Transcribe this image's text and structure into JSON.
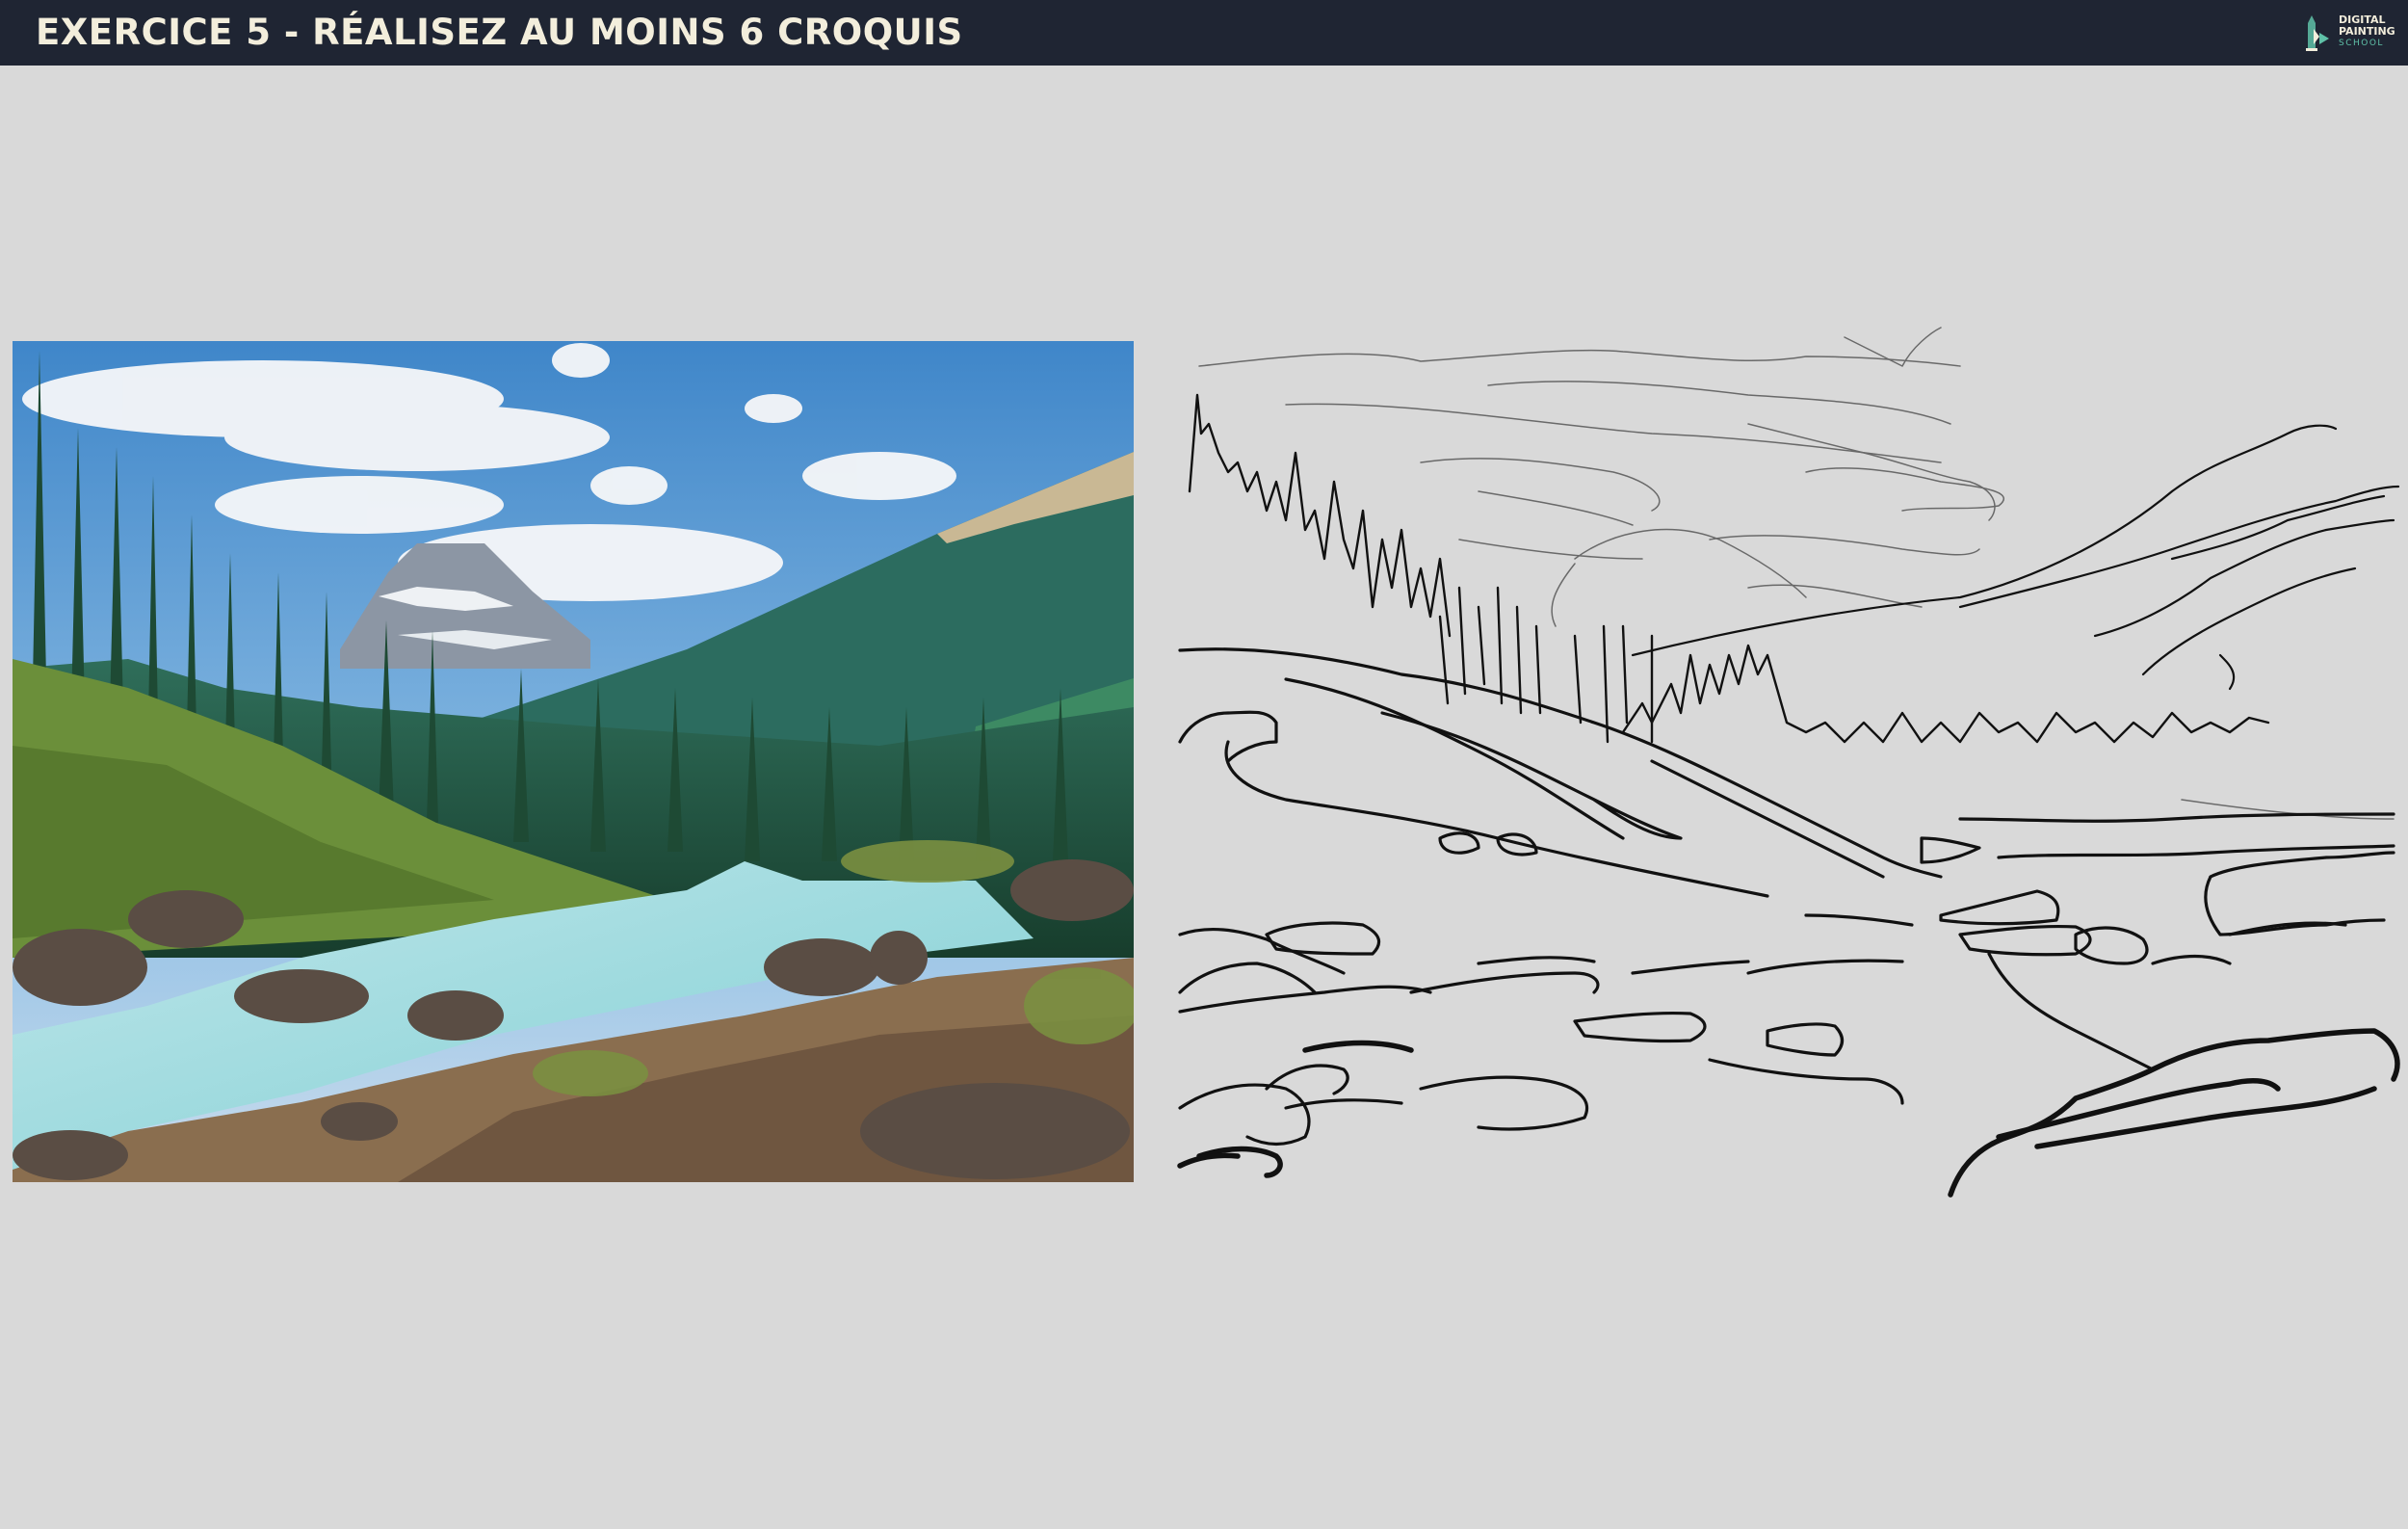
{
  "header": {
    "title": "EXERCICE 5 - RÉALISEZ AU MOINS 6 CROQUIS"
  },
  "logo": {
    "line1": "DIGITAL",
    "line2": "PAINTING",
    "line3": "SCHOOL",
    "icon": "paintbrush-logo-icon"
  },
  "colors": {
    "header_bg": "#1f2533",
    "header_text": "#f3eedc",
    "page_bg": "#d9d9d9",
    "accent": "#5fc1a8"
  },
  "main": {
    "reference_image": "mountain-river-landscape-photo",
    "sketch_image": "line-sketch-of-landscape"
  }
}
